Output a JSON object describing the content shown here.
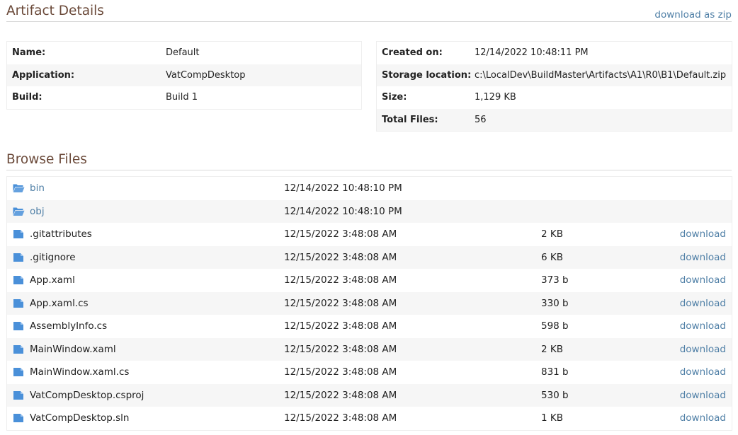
{
  "artifact": {
    "title": "Artifact Details",
    "download_zip": "download as zip",
    "left_props": [
      {
        "label": "Name:",
        "value": "Default"
      },
      {
        "label": "Application:",
        "value": "VatCompDesktop"
      },
      {
        "label": "Build:",
        "value": "Build 1"
      }
    ],
    "right_props": [
      {
        "label": "Created on:",
        "value": "12/14/2022 10:48:11 PM"
      },
      {
        "label": "Storage location:",
        "value": "c:\\LocalDev\\BuildMaster\\Artifacts\\A1\\R0\\B1\\Default.zip"
      },
      {
        "label": "Size:",
        "value": "1,129 KB"
      },
      {
        "label": "Total Files:",
        "value": "56"
      }
    ]
  },
  "browse": {
    "title": "Browse Files",
    "download_label": "download",
    "entries": [
      {
        "type": "folder",
        "icon": "folder-open-icon",
        "name": "bin",
        "date": "12/14/2022 10:48:10 PM",
        "size": ""
      },
      {
        "type": "folder",
        "icon": "folder-open-icon",
        "name": "obj",
        "date": "12/14/2022 10:48:10 PM",
        "size": ""
      },
      {
        "type": "file",
        "icon": "file-icon",
        "name": ".gitattributes",
        "date": "12/15/2022 3:48:08 AM",
        "size": "2 KB"
      },
      {
        "type": "file",
        "icon": "file-icon",
        "name": ".gitignore",
        "date": "12/15/2022 3:48:08 AM",
        "size": "6 KB"
      },
      {
        "type": "file",
        "icon": "file-icon",
        "name": "App.xaml",
        "date": "12/15/2022 3:48:08 AM",
        "size": "373 b"
      },
      {
        "type": "file",
        "icon": "file-icon",
        "name": "App.xaml.cs",
        "date": "12/15/2022 3:48:08 AM",
        "size": "330 b"
      },
      {
        "type": "file",
        "icon": "file-icon",
        "name": "AssemblyInfo.cs",
        "date": "12/15/2022 3:48:08 AM",
        "size": "598 b"
      },
      {
        "type": "file",
        "icon": "file-icon",
        "name": "MainWindow.xaml",
        "date": "12/15/2022 3:48:08 AM",
        "size": "2 KB"
      },
      {
        "type": "file",
        "icon": "file-icon",
        "name": "MainWindow.xaml.cs",
        "date": "12/15/2022 3:48:08 AM",
        "size": "831 b"
      },
      {
        "type": "file",
        "icon": "file-icon",
        "name": "VatCompDesktop.csproj",
        "date": "12/15/2022 3:48:08 AM",
        "size": "530 b"
      },
      {
        "type": "file",
        "icon": "file-icon",
        "name": "VatCompDesktop.sln",
        "date": "12/15/2022 3:48:08 AM",
        "size": "1 KB"
      }
    ]
  },
  "colors": {
    "heading": "#6b4a3a",
    "link": "#4f7fa6",
    "icon": "#4a90d9",
    "row_alt": "#f6f6f6"
  }
}
